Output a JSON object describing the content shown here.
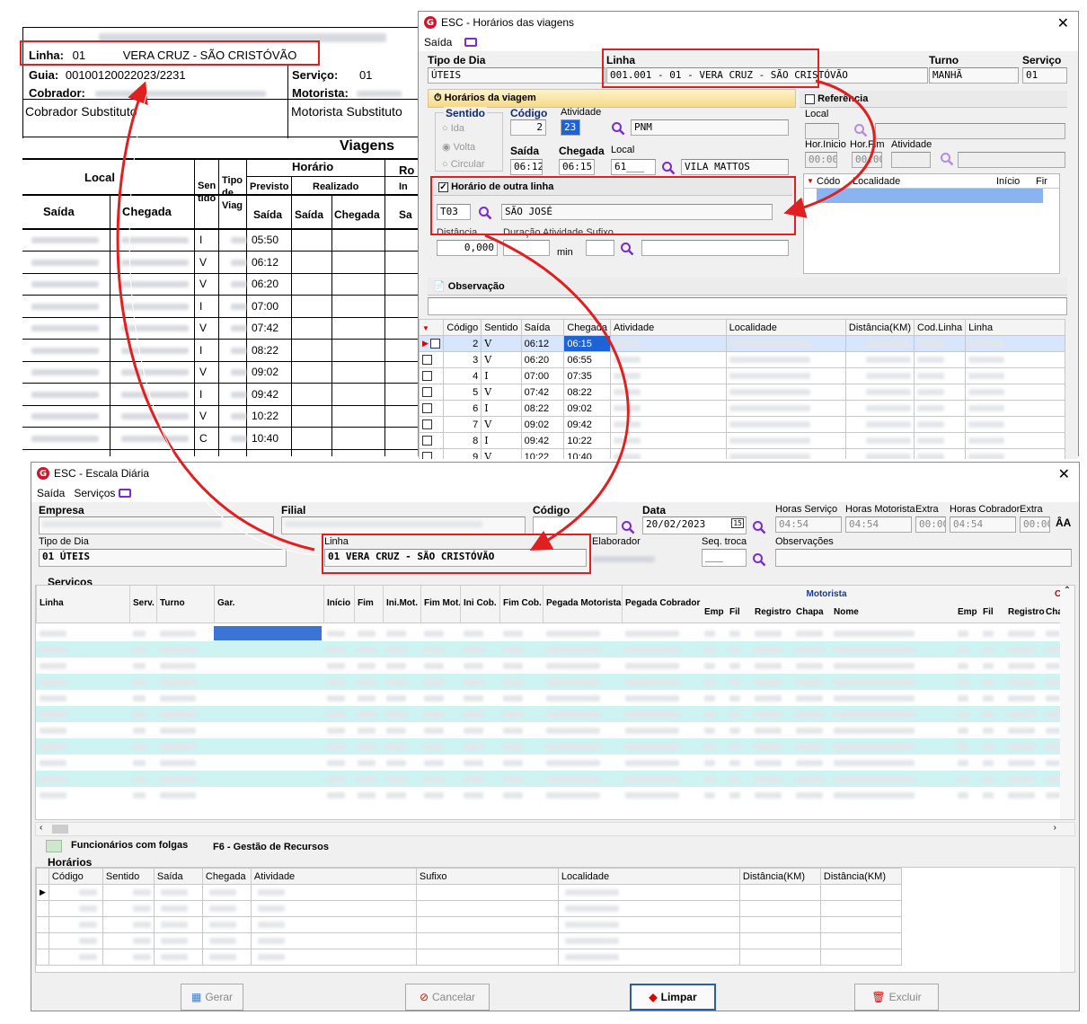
{
  "paper": {
    "linha_label": "Linha:",
    "linha_num": "01",
    "linha_name": "VERA CRUZ - SÃO CRISTÓVÃO",
    "guia_label": "Guia:",
    "guia_value": "00100120022023/2231",
    "servico_label": "Serviço:",
    "servico_value": "01",
    "cobrador_label": "Cobrador:",
    "motorista_label": "Motorista:",
    "cobrador_sub": "Cobrador Substituto",
    "motorista_sub": "Motorista Substituto",
    "viagens": "Viagens",
    "col_local": "Local",
    "col_sentido": "Sen\ntido",
    "col_tipo": "Tipo\nde\nViag",
    "col_horario": "Horário",
    "col_ro": "Ro",
    "col_in": "In",
    "col_previsto": "Previsto",
    "col_realizado": "Realizado",
    "col_saida": "Saída",
    "col_chegada": "Chegada",
    "col_sa": "Sa",
    "rows": [
      {
        "sentido": "I",
        "saida": "05:50"
      },
      {
        "sentido": "V",
        "saida": "06:12"
      },
      {
        "sentido": "V",
        "saida": "06:20"
      },
      {
        "sentido": "I",
        "saida": "07:00"
      },
      {
        "sentido": "V",
        "saida": "07:42"
      },
      {
        "sentido": "I",
        "saida": "08:22"
      },
      {
        "sentido": "V",
        "saida": "09:02"
      },
      {
        "sentido": "I",
        "saida": "09:42"
      },
      {
        "sentido": "V",
        "saida": "10:22"
      },
      {
        "sentido": "C",
        "saida": "10:40"
      }
    ]
  },
  "win1": {
    "title": "ESC - Horários das viagens",
    "menu_saida": "Saída",
    "tipo_dia_label": "Tipo de Dia",
    "tipo_dia_value": "ÚTEIS",
    "linha_label": "Linha",
    "linha_value": "001.001 - 01 - VERA CRUZ - SÃO CRISTÓVÃO",
    "turno_label": "Turno",
    "turno_value": "MANHÃ",
    "servico_label": "Serviço",
    "servico_value": "01",
    "horarios_viagem": "Horários da viagem",
    "sentido": "Sentido",
    "ida": "Ida",
    "volta": "Volta",
    "circular": "Circular",
    "codigo_label": "Código",
    "codigo_value": "2",
    "atividade_label": "Atividade",
    "atividade_code": "23",
    "atividade_name": "PNM",
    "saida_label": "Saída",
    "saida_value": "06:12",
    "chegada_label": "Chegada",
    "chegada_value": "06:15",
    "local_label": "Local",
    "local_code": "61___",
    "local_name": "VILA MATTOS",
    "referencia": "Referência",
    "ref_local": "Local",
    "hor_inicio": "Hor.Inicio",
    "hor_fim": "Hor.Fim",
    "ref_atividade": "Atividade",
    "hor_inicio_value": "00:00",
    "hor_fim_value": "00:00",
    "ref_col_codigo": "Códo",
    "ref_col_localidade": "Localidade",
    "ref_col_inicio": "Início",
    "ref_col_fim": "Fir",
    "outra_linha": "Horário de outra linha",
    "outra_code": "T03",
    "outra_name": "SÃO JOSÉ",
    "distancia": "Distância",
    "duracao": "Duração Atividade Sufixo",
    "distancia_value": "0,000",
    "min": "min",
    "observacao": "Observação",
    "grid_headers": [
      "Código",
      "Sentido",
      "Saída",
      "Chegada",
      "Atividade",
      "Localidade",
      "Distância(KM)",
      "Cod.Linha",
      "Linha"
    ],
    "grid_rows": [
      {
        "codigo": "2",
        "sentido": "V",
        "saida": "06:12",
        "chegada": "06:15"
      },
      {
        "codigo": "3",
        "sentido": "V",
        "saida": "06:20",
        "chegada": "06:55"
      },
      {
        "codigo": "4",
        "sentido": "I",
        "saida": "07:00",
        "chegada": "07:35"
      },
      {
        "codigo": "5",
        "sentido": "V",
        "saida": "07:42",
        "chegada": "08:22"
      },
      {
        "codigo": "6",
        "sentido": "I",
        "saida": "08:22",
        "chegada": "09:02"
      },
      {
        "codigo": "7",
        "sentido": "V",
        "saida": "09:02",
        "chegada": "09:42"
      },
      {
        "codigo": "8",
        "sentido": "I",
        "saida": "09:42",
        "chegada": "10:22"
      },
      {
        "codigo": "9",
        "sentido": "V",
        "saida": "10:22",
        "chegada": "10:40"
      }
    ]
  },
  "win2": {
    "title": "ESC - Escala Diária",
    "menu_saida": "Saída",
    "menu_servicos": "Serviços",
    "empresa_label": "Empresa",
    "filial_label": "Filial",
    "codigo_label": "Código",
    "data_label": "Data",
    "data_value": "20/02/2023",
    "data_cal": "15",
    "horas_servico_label": "Horas Serviço",
    "horas_servico_value": "04:54",
    "horas_motorista_label": "Horas Motorista",
    "horas_motorista_value": "04:54",
    "extra_label": "Extra",
    "extra_value": "00:00",
    "horas_cobrador_label": "Horas Cobrador",
    "horas_cobrador_value": "04:54",
    "extra2_label": "Extra",
    "extra2_value": "00:00",
    "tipo_dia_label": "Tipo de Dia",
    "tipo_dia_value": "01 ÚTEIS",
    "linha_label": "Linha",
    "linha_value": "01 VERA CRUZ - SÃO CRISTÓVÃO",
    "elaborador_label": "Elaborador",
    "seq_troca_label": "Seq. troca",
    "seq_troca_value": "___",
    "observacoes_label": "Observações",
    "servicos_section": "Serviços",
    "serv_headers": [
      "Linha",
      "Serv.",
      "Turno",
      "Gar.",
      "Início",
      "Fim",
      "Ini.Mot.",
      "Fim Mot.",
      "Ini Cob.",
      "Fim Cob.",
      "Pegada Motorista",
      "Pegada Cobrador"
    ],
    "motorista_group": "Motorista",
    "cobrador_group": "C",
    "mot_sub": [
      "Emp",
      "Fil",
      "Registro",
      "Chapa",
      "Nome"
    ],
    "cob_sub": [
      "Emp",
      "Fil",
      "Registro",
      "Cha"
    ],
    "funcionarios_folgas": "Funcionários com folgas",
    "f6": "F6 - Gestão de Recursos",
    "horarios_section": "Horários",
    "hor_headers": [
      "Código",
      "Sentido",
      "Saída",
      "Chegada",
      "Atividade",
      "Sufixo",
      "Localidade",
      "Distância(KM)",
      "Distância(KM)"
    ],
    "btn_gerar": "Gerar",
    "btn_cancelar": "Cancelar",
    "btn_limpar": "Limpar",
    "btn_excluir": "Excluir"
  },
  "colors": {
    "highlight": "#e02020",
    "accent": "#2a5fa8",
    "row_alt": "#cdf3f3"
  }
}
